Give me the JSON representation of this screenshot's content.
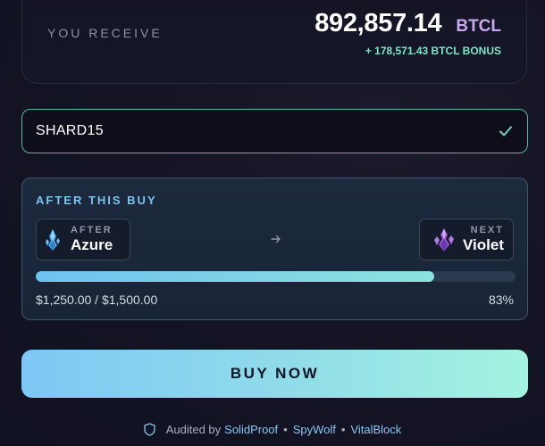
{
  "receive": {
    "label": "YOU RECEIVE",
    "amount": "892,857.14",
    "ticker": "BTCL",
    "bonus": "+ 178,571.43 BTCL BONUS"
  },
  "promo": {
    "value": "SHARD15",
    "valid_icon": "check-icon",
    "accent": "#5ab8a2"
  },
  "tier_progress": {
    "title": "AFTER THIS BUY",
    "current": {
      "kicker": "AFTER",
      "name": "Azure",
      "icon": "azure-crystal-icon"
    },
    "next": {
      "kicker": "NEXT",
      "name": "Violet",
      "icon": "violet-crystal-icon"
    },
    "progress_label": "$1,250.00 / $1,500.00",
    "progress_fraction": 0.83,
    "progress_percent": "83%"
  },
  "buy_button": {
    "label": "BUY NOW"
  },
  "audit": {
    "prefix": "Audited by",
    "auditors": [
      "SolidProof",
      "SpyWolf",
      "VitalBlock"
    ],
    "separator": "•",
    "icon": "shield-icon"
  },
  "colors": {
    "bonus": "#7fe6c6",
    "ticker": "#c8a8f0",
    "accent_blue": "#7cc4ee",
    "button_gradient_start": "#7dc8f4",
    "button_gradient_end": "#a2f4e0"
  }
}
